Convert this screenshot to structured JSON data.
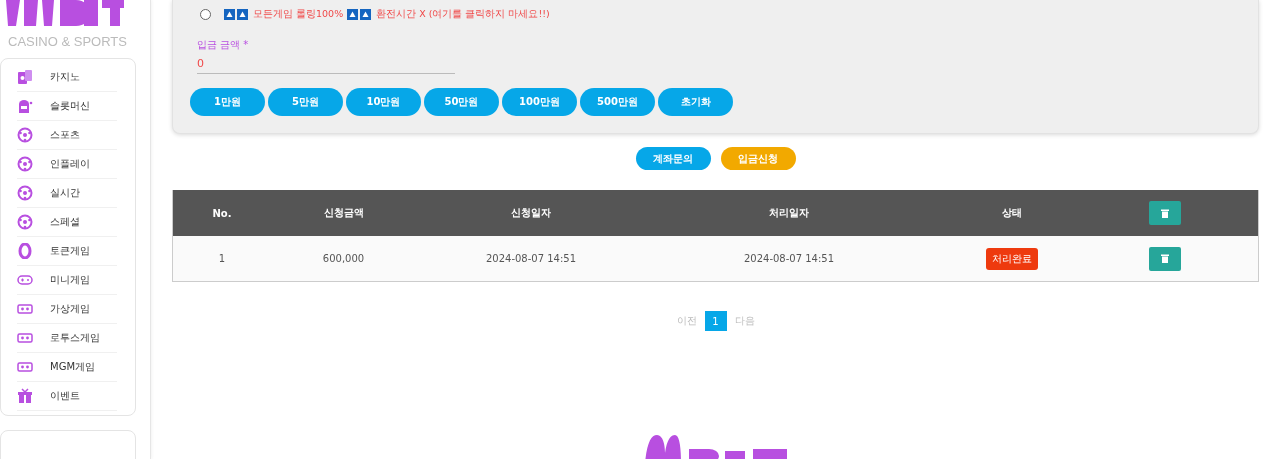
{
  "logo": {
    "tagline": "CASINO & SPORTS"
  },
  "sidebar": {
    "items": [
      {
        "label": "카지노",
        "kind": "cards"
      },
      {
        "label": "슬롯머신",
        "kind": "slot"
      },
      {
        "label": "스포츠",
        "kind": "ball"
      },
      {
        "label": "인플레이",
        "kind": "ball"
      },
      {
        "label": "실시간",
        "kind": "ball"
      },
      {
        "label": "스페셜",
        "kind": "ball"
      },
      {
        "label": "토큰게임",
        "kind": "token"
      },
      {
        "label": "미니게임",
        "kind": "gamepad"
      },
      {
        "label": "가상게임",
        "kind": "vr"
      },
      {
        "label": "로투스게임",
        "kind": "vr"
      },
      {
        "label": "MGM게임",
        "kind": "vr"
      },
      {
        "label": "이벤트",
        "kind": "gift"
      }
    ]
  },
  "bonus_option": {
    "selected": false,
    "parts": [
      {
        "kind": "icons"
      },
      {
        "kind": "text",
        "text": "모든게임 롤링100%"
      },
      {
        "kind": "icons"
      },
      {
        "kind": "text",
        "text": "환전시간 X (여기를 클릭하지 마세요!!)"
      }
    ]
  },
  "amount_field": {
    "label": "입금 금액 *",
    "value": "0"
  },
  "amount_buttons": [
    "1만원",
    "5만원",
    "10만원",
    "50만원",
    "100만원",
    "500만원",
    "초기화"
  ],
  "actions": [
    {
      "label": "계좌문의",
      "color": "#06a7e8"
    },
    {
      "label": "입금신청",
      "color": "#f2a900"
    }
  ],
  "table": {
    "columns": [
      "No.",
      "신청금액",
      "신청일자",
      "처리일자",
      "상태"
    ],
    "rows": [
      {
        "no": "1",
        "amount": "600,000",
        "requested": "2024-08-07 14:51",
        "processed": "2024-08-07 14:51",
        "status": "처리완료"
      }
    ]
  },
  "pagination": {
    "prev": "이전",
    "pages": [
      {
        "label": "1",
        "selected": true
      }
    ],
    "next": "다음"
  }
}
